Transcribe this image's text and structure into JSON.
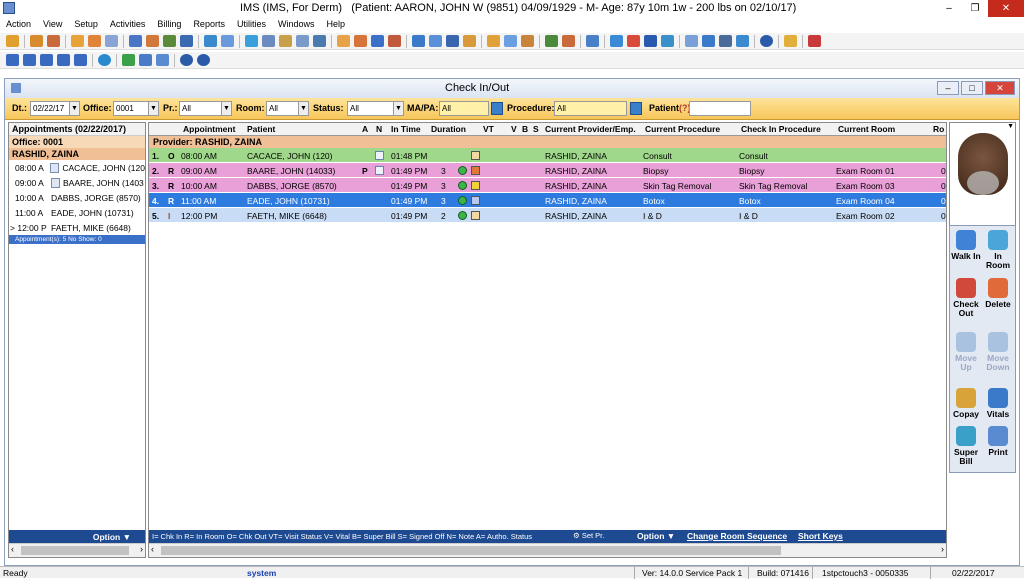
{
  "window": {
    "title": "IMS (IMS, For Derm)",
    "patient_info": "(Patient: AARON, JOHN W (9851) 04/09/1929 - M- Age: 87y 10m 1w - 200 lbs on 02/10/17)"
  },
  "menu": [
    "Action",
    "View",
    "Setup",
    "Activities",
    "Billing",
    "Reports",
    "Utilities",
    "Windows",
    "Help"
  ],
  "dialog": {
    "title": "Check In/Out"
  },
  "filters": {
    "dt_label": "Dt.:",
    "dt_value": "02/22/17",
    "office_label": "Office:",
    "office_value": "0001",
    "pr_label": "Pr.:",
    "pr_value": "All",
    "room_label": "Room:",
    "room_value": "All",
    "status_label": "Status:",
    "status_value": "All",
    "mapa_label": "MA/PA:",
    "mapa_value": "All",
    "procedure_label": "Procedure:",
    "procedure_value": "All",
    "patient_label": "Patient",
    "patient_hint": "(?)"
  },
  "left_panel": {
    "header": "Appointments (02/22/2017)",
    "office": "Office: 0001",
    "provider": "RASHID, ZAINA",
    "items": [
      {
        "time": "08:00 A",
        "name": "CACACE, JOHN  (120"
      },
      {
        "time": "09:00 A",
        "name": "BAARE, JOHN  (1403"
      },
      {
        "time": "10:00 A",
        "name": "DABBS, JORGE  (8570)"
      },
      {
        "time": "11:00 A",
        "name": "EADE, JOHN  (10731)"
      },
      {
        "time": "12:00 P",
        "name": "FAETH, MIKE  (6648)",
        "marker": ">"
      }
    ],
    "count": "Appointment(s): 5   No Show: 0",
    "option": "Option"
  },
  "grid": {
    "columns": [
      "Appointment",
      "Patient",
      "A",
      "N",
      "In Time",
      "Duration",
      "VT",
      "V",
      "B",
      "S",
      "Current Provider/Emp.",
      "Current Procedure",
      "Check In Procedure",
      "Current Room",
      "Ro"
    ],
    "provider": "Provider:  RASHID, ZAINA",
    "rows": [
      {
        "num": "1.",
        "status": "O",
        "appt": "08:00 AM",
        "patient": "CACACE, JOHN  (120)",
        "a": "",
        "in_time": "01:48 PM",
        "duration": "",
        "provider": "RASHID, ZAINA",
        "cur_proc": "Consult",
        "ci_proc": "Consult",
        "room": "",
        "ro": ""
      },
      {
        "num": "2.",
        "status": "R",
        "appt": "09:00 AM",
        "patient": "BAARE, JOHN  (14033)",
        "a": "P",
        "in_time": "01:49 PM",
        "duration": "3",
        "provider": "RASHID, ZAINA",
        "cur_proc": "Biopsy",
        "ci_proc": "Biopsy",
        "room": "Exam Room 01",
        "ro": "0"
      },
      {
        "num": "3.",
        "status": "R",
        "appt": "10:00 AM",
        "patient": "DABBS, JORGE  (8570)",
        "a": "",
        "in_time": "01:49 PM",
        "duration": "3",
        "provider": "RASHID, ZAINA",
        "cur_proc": "Skin Tag Removal",
        "ci_proc": "Skin Tag Removal",
        "room": "Exam Room 03",
        "ro": "0"
      },
      {
        "num": "4.",
        "status": "R",
        "appt": "11:00 AM",
        "patient": "EADE, JOHN  (10731)",
        "a": "",
        "in_time": "01:49 PM",
        "duration": "3",
        "provider": "RASHID, ZAINA",
        "cur_proc": "Botox",
        "ci_proc": "Botox",
        "room": "Exam Room 04",
        "ro": "0"
      },
      {
        "num": "5.",
        "status": "I",
        "appt": "12:00 PM",
        "patient": "FAETH, MIKE  (6648)",
        "a": "",
        "in_time": "01:49 PM",
        "duration": "2",
        "provider": "RASHID, ZAINA",
        "cur_proc": "I & D",
        "ci_proc": "I & D",
        "room": "Exam Room 02",
        "ro": "0"
      }
    ],
    "legend": "I= Chk In  R= In Room  O= Chk Out  VT= Visit Status  V= Vital  B= Super Bill  S= Signed Off  N= Note  A= Autho. Status",
    "set_pr": "Set Pr.",
    "option": "Option",
    "change_room": "Change Room Sequence",
    "short_keys": "Short Keys"
  },
  "actions": [
    {
      "label": "Walk In"
    },
    {
      "label": "In Room"
    },
    {
      "label": "Check Out"
    },
    {
      "label": "Delete"
    },
    {
      "label": "Move Up"
    },
    {
      "label": "Move Down"
    },
    {
      "label": "Copay"
    },
    {
      "label": "Vitals"
    },
    {
      "label": "Super Bill"
    },
    {
      "label": "Print"
    }
  ],
  "status": {
    "ready": "Ready",
    "user": "system",
    "version": "Ver: 14.0.0 Service Pack 1",
    "build": "Build: 071416",
    "server": "1stpctouch3 - 0050335",
    "date": "02/22/2017"
  },
  "colors": {
    "done": "#9fd88a",
    "in_room": "#e9a0d8",
    "selected": "#2e7be0",
    "checked_in": "#c9dcf5",
    "provider_band": "#f1bf96",
    "bar": "#1e4a91"
  }
}
